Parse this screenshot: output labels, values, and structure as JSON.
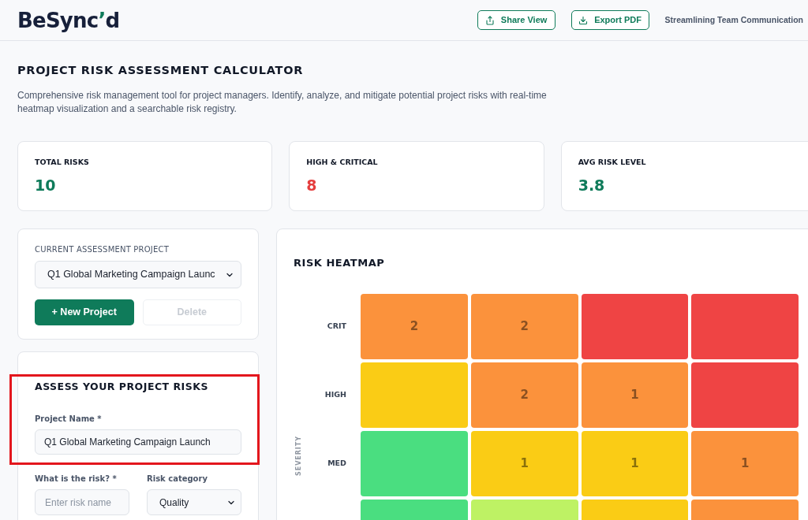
{
  "header": {
    "logo": {
      "name": "BeSync",
      "accent": "’",
      "suffix": "d"
    },
    "actions": [
      {
        "label": "Share View",
        "kind": "share"
      },
      {
        "label": "Export PDF",
        "kind": "export"
      }
    ],
    "tagline": "Streamlining Team Communication"
  },
  "page": {
    "title": "PROJECT RISK ASSESSMENT CALCULATOR",
    "description": "Comprehensive risk management tool for project managers. Identify, analyze, and mitigate potential project risks with real-time heatmap visualization and a searchable risk registry."
  },
  "stats": [
    {
      "label": "TOTAL RISKS",
      "value": "10",
      "color": "#0f7b5a"
    },
    {
      "label": "HIGH & CRITICAL",
      "value": "8",
      "color": "#e53e3e"
    },
    {
      "label": "AVG RISK LEVEL",
      "value": "3.8",
      "color": "#0f7b5a"
    }
  ],
  "project_selector": {
    "label": "CURRENT ASSESSMENT PROJECT",
    "value": "Q1 Global Marketing Campaign Launc",
    "buttons": [
      {
        "label": "+ New Project",
        "disabled": false
      },
      {
        "label": "Delete",
        "disabled": true
      }
    ]
  },
  "assessment_form": {
    "title": "ASSESS YOUR PROJECT RISKS",
    "highlighted": true,
    "rows": [
      [
        {
          "label": "Project Name *",
          "kind": "text",
          "value": "Q1 Global Marketing Campaign Launch"
        }
      ],
      [
        {
          "label": "What is the risk? *",
          "kind": "text",
          "placeholder": "Enter risk name"
        },
        {
          "label": "Risk category",
          "kind": "select",
          "value": "Quality"
        }
      ]
    ]
  },
  "heatmap": {
    "title": "RISK HEATMAP",
    "axis_label": "SEVERITY",
    "rows": [
      {
        "label": "CRIT",
        "cells": [
          {
            "color": "#fb923c",
            "count": "2"
          },
          {
            "color": "#fb923c",
            "count": "2"
          },
          {
            "color": "#ef4444"
          },
          {
            "color": "#ef4444"
          }
        ]
      },
      {
        "label": "HIGH",
        "cells": [
          {
            "color": "#facc15"
          },
          {
            "color": "#fb923c",
            "count": "2"
          },
          {
            "color": "#fb923c",
            "count": "1"
          },
          {
            "color": "#ef4444"
          }
        ]
      },
      {
        "label": "MED",
        "cells": [
          {
            "color": "#4ade80"
          },
          {
            "color": "#facc15",
            "count": "1"
          },
          {
            "color": "#facc15",
            "count": "1"
          },
          {
            "color": "#fb923c",
            "count": "1"
          }
        ]
      },
      {
        "cells": [
          {
            "color": "#4ade80"
          },
          {
            "color": "#bef264"
          },
          {
            "color": "#facc15"
          },
          {
            "color": "#fb923c"
          }
        ]
      }
    ]
  }
}
